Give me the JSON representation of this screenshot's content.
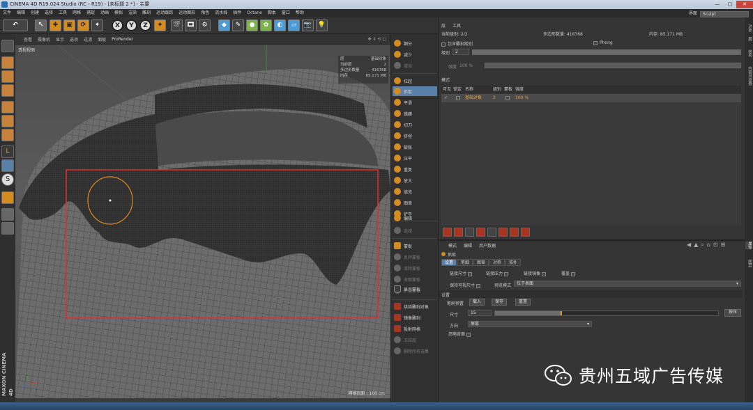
{
  "window": {
    "title": "CINEMA 4D R19.024 Studio (RC - R19) - [未标题 2 *] - 主要",
    "min": "—",
    "max": "□",
    "close": "✕"
  },
  "menu": [
    "文件",
    "编辑",
    "创建",
    "选择",
    "工具",
    "网格",
    "捕捉",
    "动画",
    "模拟",
    "渲染",
    "雕刻",
    "运动跟踪",
    "运动图形",
    "角色",
    "流水线",
    "插件",
    "Octane",
    "脚本",
    "窗口",
    "帮助"
  ],
  "layout": {
    "label": "界面",
    "value": "Sculpt"
  },
  "toolbar": {
    "undo": "↶",
    "x": "X",
    "y": "Y",
    "z": "Z"
  },
  "viewport": {
    "menu": [
      "查看",
      "摄像机",
      "显示",
      "选项",
      "过滤",
      "面板",
      "ProRender"
    ],
    "label": "透视视图",
    "info": [
      [
        "层",
        "基础对象"
      ],
      [
        "当前层",
        "2"
      ],
      [
        "多边形数量",
        "416768"
      ],
      [
        "内存",
        "85.171 MB"
      ]
    ],
    "grid": "网格间距 : 100 cm",
    "brush_color": "#e08a1e",
    "selection_color": "#e03030"
  },
  "maxon": "MAXON CINEMA 4D",
  "sculpt_tools": [
    {
      "label": "细分",
      "state": "normal"
    },
    {
      "label": "减少",
      "state": "normal"
    },
    {
      "label": "增加",
      "state": "disabled"
    },
    {
      "label": "拉起",
      "state": "normal"
    },
    {
      "label": "抓取",
      "state": "selected"
    },
    {
      "label": "平滑",
      "state": "normal"
    },
    {
      "label": "蜡膜",
      "state": "normal"
    },
    {
      "label": "切刀",
      "state": "normal"
    },
    {
      "label": "挤捏",
      "state": "normal"
    },
    {
      "label": "膨胀",
      "state": "normal"
    },
    {
      "label": "压平",
      "state": "normal"
    },
    {
      "label": "重复",
      "state": "normal"
    },
    {
      "label": "放大",
      "state": "normal"
    },
    {
      "label": "填充",
      "state": "normal"
    },
    {
      "label": "图章",
      "state": "normal"
    },
    {
      "label": "铲平",
      "state": "normal"
    },
    {
      "label": "编辑",
      "state": "normal"
    },
    {
      "label": "选择",
      "state": "disabled"
    }
  ],
  "mask_tools": [
    {
      "label": "蒙板",
      "state": "normal"
    },
    {
      "label": "反转蒙板",
      "state": "disabled"
    },
    {
      "label": "清除蒙板",
      "state": "disabled"
    },
    {
      "label": "收缩蒙板",
      "state": "disabled"
    },
    {
      "label": "扩展蒙板",
      "state": "disabled"
    },
    {
      "label": "显示蒙板",
      "state": "normal"
    }
  ],
  "bake_tools": [
    {
      "label": "烘焙雕刻对象",
      "state": "normal"
    },
    {
      "label": "镜像雕刻",
      "state": "normal"
    },
    {
      "label": "投射网格",
      "state": "normal"
    },
    {
      "label": "冻结层",
      "state": "disabled"
    },
    {
      "label": "删除所有选集",
      "state": "disabled"
    }
  ],
  "layers_panel": {
    "tabs": [
      "层",
      "工具"
    ],
    "stats": {
      "cur_label": "当前级别: 2/2",
      "poly_label": "多边形数量: 416768",
      "mem_label": "内存: 85.171 MB"
    },
    "include_label": "包含雕刻级别",
    "phong_label": "Phong",
    "level_label": "级别",
    "level_value": "2",
    "strength_label": "强度",
    "strength_value": "100 %",
    "layers_title": "模式",
    "columns": [
      "可见",
      "锁定",
      "名称",
      "级别",
      "蒙板",
      "强度"
    ],
    "row": {
      "name": "基础对象",
      "level": "2",
      "strength": "100 %"
    }
  },
  "attr_panel": {
    "menu": [
      "模式",
      "编辑",
      "用户数据"
    ],
    "tool_name": "抓取",
    "tabs": [
      "设置",
      "笔触",
      "图章",
      "对称",
      "拓扑"
    ],
    "opts": {
      "a": "链接尺寸",
      "b": "链接压力",
      "c": "链接镜像",
      "d": "覆盖",
      "e": "保持可视尺寸",
      "f": "预览模式",
      "mode": "位于表面"
    },
    "section": "设置",
    "preset_label": "笔刷预置",
    "load": "载入",
    "save": "保存",
    "reset": "重置",
    "size_label": "尺寸",
    "size_value": "15",
    "size_fraction": 0.3,
    "size_btn": "按压",
    "dir_label": "方向",
    "dir_value": "屏幕",
    "backface_label": "忽略背面"
  },
  "edge_tabs_top": [
    "对象",
    "层",
    "结构",
    "内容浏览器"
  ],
  "edge_tabs_bottom": [
    "属性",
    "图层"
  ],
  "watermark": "贵州五域广告传媒"
}
